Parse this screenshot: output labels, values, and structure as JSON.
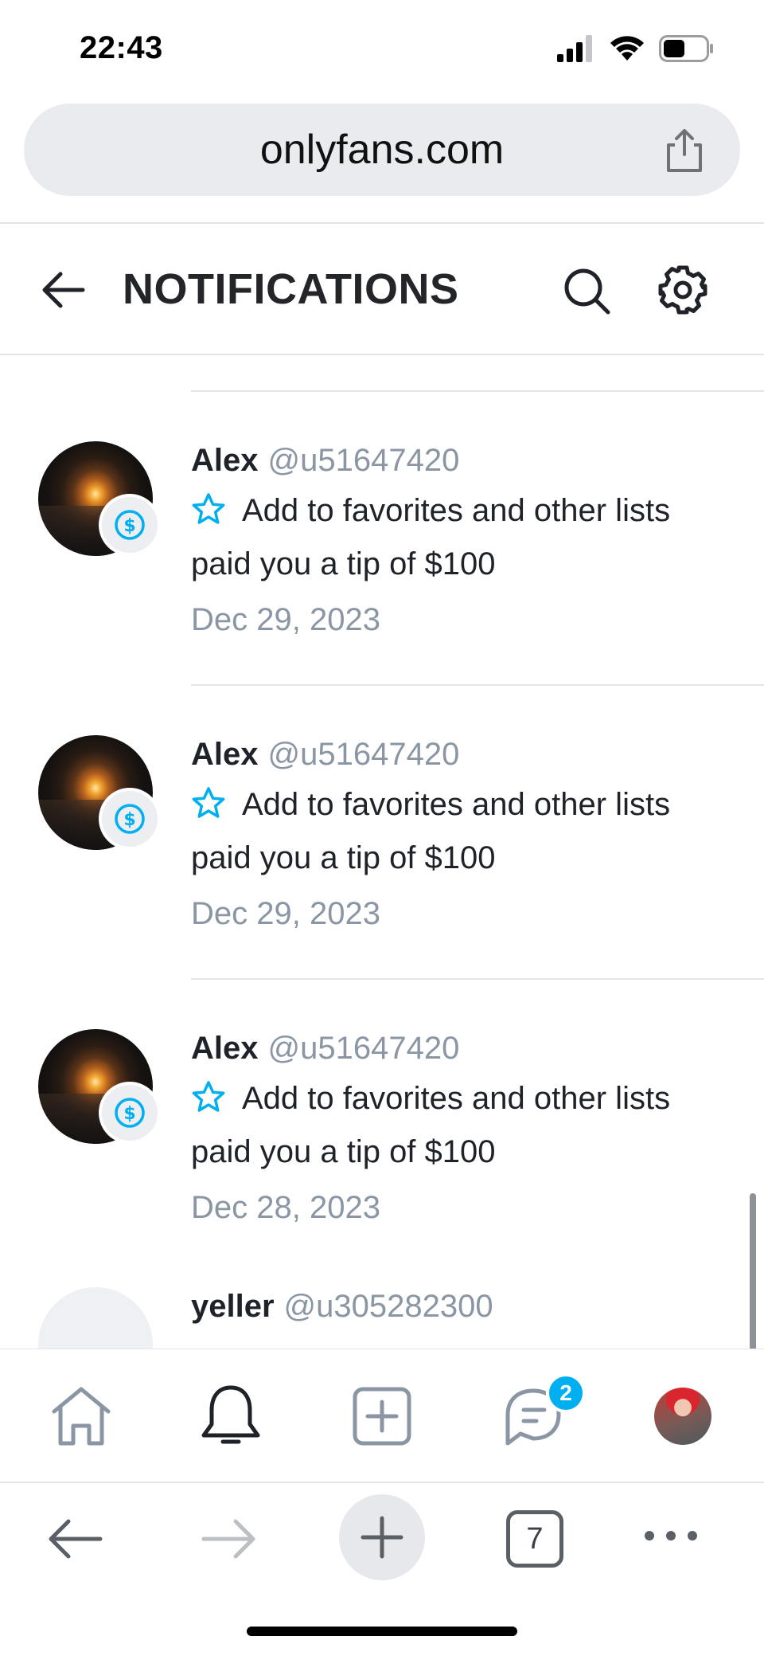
{
  "status_bar": {
    "time": "22:43"
  },
  "browser": {
    "url": "onlyfans.com",
    "tabs_count": "7"
  },
  "header": {
    "title": "NOTIFICATIONS"
  },
  "notifications": [
    {
      "name": "Alex",
      "handle": "@u51647420",
      "list_action": "Add to favorites and other lists",
      "message": "paid you a tip of $100",
      "date": "Dec 29, 2023"
    },
    {
      "name": "Alex",
      "handle": "@u51647420",
      "list_action": "Add to favorites and other lists",
      "message": "paid you a tip of $100",
      "date": "Dec 29, 2023"
    },
    {
      "name": "Alex",
      "handle": "@u51647420",
      "list_action": "Add to favorites and other lists",
      "message": "paid you a tip of $100",
      "date": "Dec 28, 2023"
    }
  ],
  "partial_notification": {
    "name": "yeller",
    "handle": "@u305282300"
  },
  "bottom_nav": {
    "messages_badge": "2"
  },
  "colors": {
    "accent": "#00aff0",
    "muted": "#8a96a3",
    "text": "#1f2329"
  },
  "icons": [
    "signal-icon",
    "wifi-icon",
    "battery-icon",
    "share-icon",
    "back-arrow-icon",
    "search-icon",
    "gear-icon",
    "dollar-icon",
    "star-icon",
    "home-icon",
    "bell-icon",
    "add-post-icon",
    "messages-icon",
    "browser-back-icon",
    "browser-forward-icon",
    "new-tab-icon",
    "more-icon"
  ]
}
